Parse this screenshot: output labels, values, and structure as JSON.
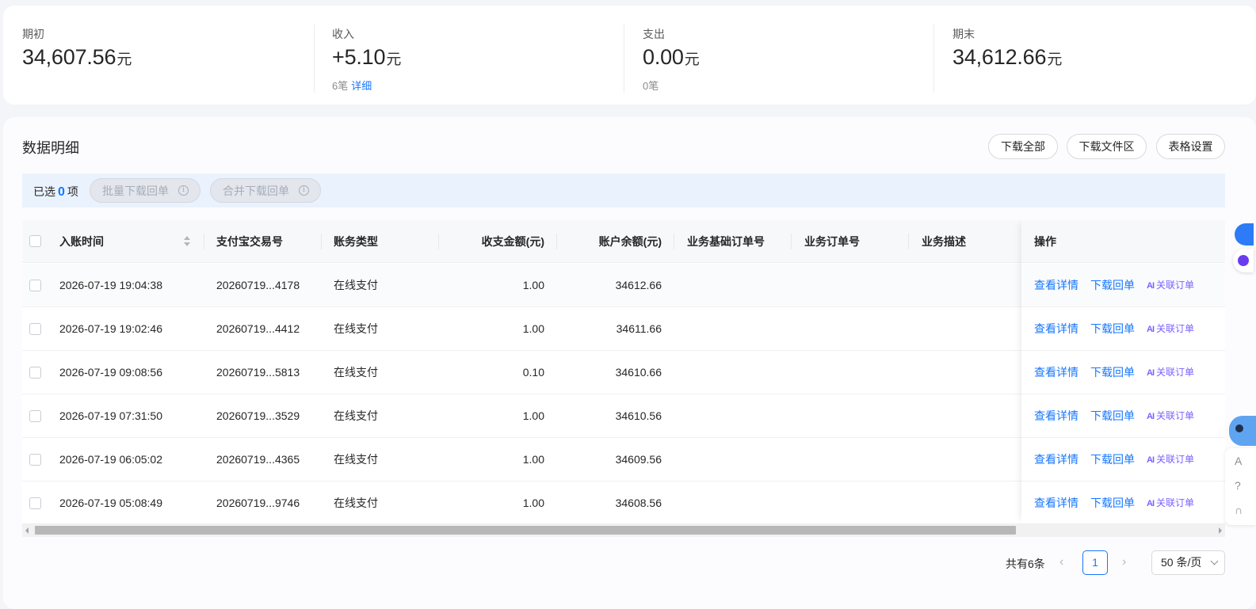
{
  "summary": {
    "opening": {
      "label": "期初",
      "value": "34,607.56",
      "unit": "元"
    },
    "income": {
      "label": "收入",
      "value": "+5.10",
      "unit": "元",
      "count": "6笔",
      "link": "详细"
    },
    "expense": {
      "label": "支出",
      "value": "0.00",
      "unit": "元",
      "count": "0笔"
    },
    "closing": {
      "label": "期末",
      "value": "34,612.66",
      "unit": "元"
    }
  },
  "detail": {
    "title": "数据明细",
    "buttons": {
      "download_all": "下载全部",
      "download_area": "下载文件区",
      "table_settings": "表格设置"
    },
    "selection": {
      "prefix": "已选",
      "count": "0",
      "suffix": "项",
      "batch_download": "批量下载回单",
      "merge_download": "合并下载回单"
    }
  },
  "table": {
    "columns": {
      "time": "入账时间",
      "trade_no": "支付宝交易号",
      "type": "账务类型",
      "amount": "收支金额(元)",
      "balance": "账户余额(元)",
      "base_order": "业务基础订单号",
      "order": "业务订单号",
      "desc": "业务描述",
      "ops": "操作"
    },
    "rows": [
      {
        "time": "2026-07-19 19:04:38",
        "trade_no": "20260719...4178",
        "type": "在线支付",
        "amount": "1.00",
        "balance": "34612.66"
      },
      {
        "time": "2026-07-19 19:02:46",
        "trade_no": "20260719...4412",
        "type": "在线支付",
        "amount": "1.00",
        "balance": "34611.66"
      },
      {
        "time": "2026-07-19 09:08:56",
        "trade_no": "20260719...5813",
        "type": "在线支付",
        "amount": "0.10",
        "balance": "34610.66"
      },
      {
        "time": "2026-07-19 07:31:50",
        "trade_no": "20260719...3529",
        "type": "在线支付",
        "amount": "1.00",
        "balance": "34610.56"
      },
      {
        "time": "2026-07-19 06:05:02",
        "trade_no": "20260719...4365",
        "type": "在线支付",
        "amount": "1.00",
        "balance": "34609.56"
      },
      {
        "time": "2026-07-19 05:08:49",
        "trade_no": "20260719...9746",
        "type": "在线支付",
        "amount": "1.00",
        "balance": "34608.56"
      }
    ],
    "actions": {
      "view": "查看详情",
      "download": "下载回单",
      "link_order": "关联订单"
    },
    "link_icon": "AI"
  },
  "pagination": {
    "total": "共有6条",
    "current_page": "1",
    "page_size": "50 条/页"
  },
  "colors": {
    "accent": "#1677ff",
    "link_order": "#7b61ff"
  }
}
